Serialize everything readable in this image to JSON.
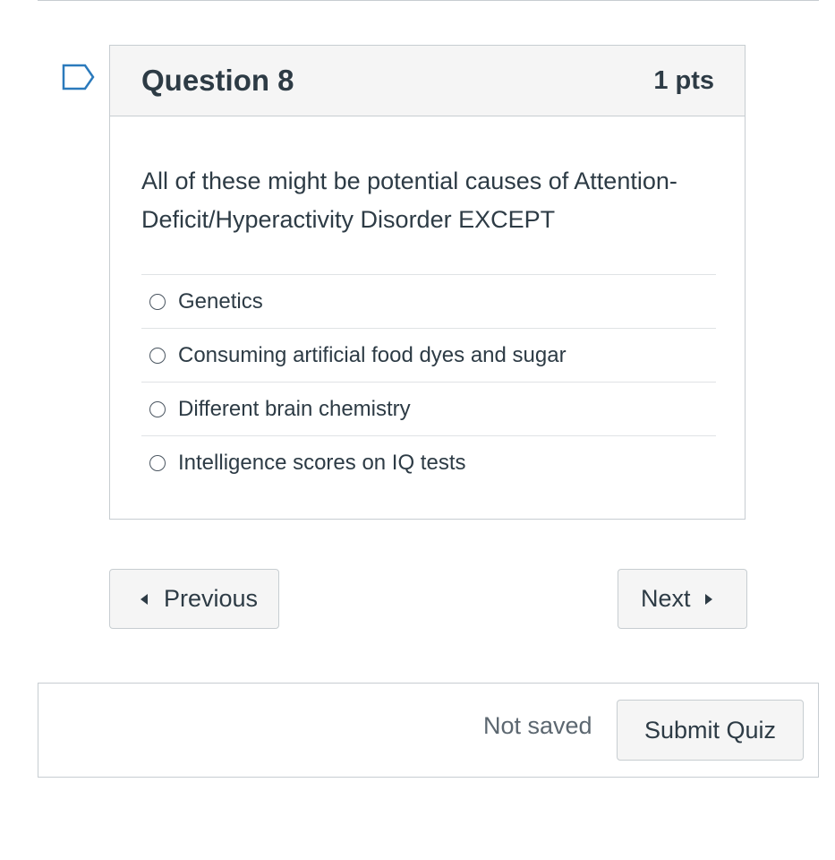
{
  "question": {
    "title": "Question 8",
    "points": "1 pts",
    "text": "All of these might be potential causes of Attention-Deficit/Hyperactivity Disorder EXCEPT",
    "answers": [
      {
        "label": "Genetics"
      },
      {
        "label": "Consuming artificial food dyes and sugar"
      },
      {
        "label": "Different brain chemistry"
      },
      {
        "label": "Intelligence scores on IQ tests"
      }
    ]
  },
  "nav": {
    "previous_label": "Previous",
    "next_label": "Next"
  },
  "footer": {
    "status": "Not saved",
    "submit_label": "Submit Quiz"
  },
  "icons": {
    "flag": "bookmark-flag-icon",
    "prev": "caret-left-icon",
    "next": "caret-right-icon"
  },
  "colors": {
    "text": "#2d3b45",
    "flag": "#2b7abc",
    "border": "#c7cdd1",
    "header_bg": "#f5f5f5"
  }
}
